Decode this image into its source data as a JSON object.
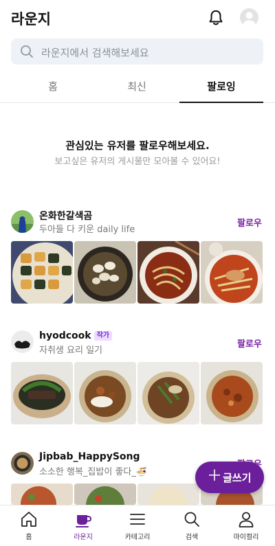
{
  "header": {
    "title": "라운지",
    "bell_icon": "bell-icon",
    "avatar_icon": "profile-avatar-icon"
  },
  "search": {
    "placeholder": "라운지에서 검색해보세요",
    "icon": "search-icon"
  },
  "tabs": [
    {
      "label": "홈",
      "active": false
    },
    {
      "label": "최신",
      "active": false
    },
    {
      "label": "팔로잉",
      "active": true
    }
  ],
  "empty_state": {
    "title": "관심있는 유저를 팔로우해보세요.",
    "subtitle": "보고싶은 유저의 게시물만 모아볼 수 있어요!"
  },
  "recommendations": [
    {
      "name": "온화한갈색곰",
      "bio": "두아들 다 키운 daily life",
      "badge": "",
      "follow_label": "팔로우"
    },
    {
      "name": "hyodcook",
      "bio": "자취생 요리 일기",
      "badge": "작가",
      "follow_label": "팔로우"
    },
    {
      "name": "Jipbab_HappySong",
      "bio": "소소한 행복_집밥이 좋다_🍜",
      "badge": "",
      "follow_label": "팔로우"
    }
  ],
  "fab": {
    "label": "글쓰기",
    "icon": "plus-icon"
  },
  "bottom_nav": [
    {
      "label": "홈",
      "icon": "home-icon",
      "active": false
    },
    {
      "label": "라운지",
      "icon": "cup-icon",
      "active": true
    },
    {
      "label": "카테고리",
      "icon": "menu-icon",
      "active": false
    },
    {
      "label": "검색",
      "icon": "search-icon",
      "active": false
    },
    {
      "label": "마이컬리",
      "icon": "person-icon",
      "active": false
    }
  ],
  "colors": {
    "accent": "#6b1f9a",
    "follow": "#7a1fa2",
    "search_bg": "#eef2f6"
  }
}
